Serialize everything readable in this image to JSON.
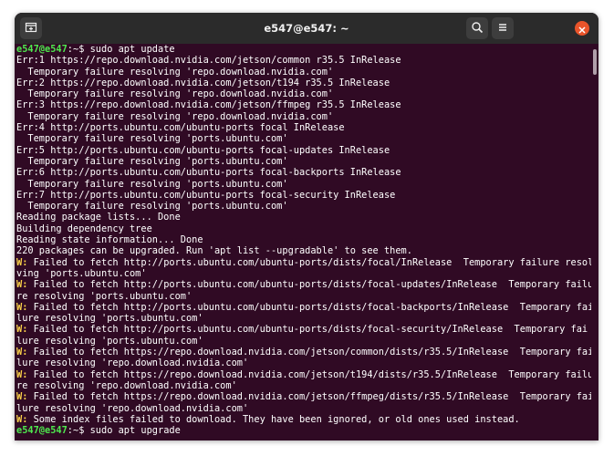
{
  "window": {
    "title": "e547@e547: ~"
  },
  "icons": {
    "new_tab": "new-tab-icon",
    "search": "search-icon",
    "menu": "hamburger-menu-icon",
    "close": "close-icon"
  },
  "colors": {
    "terminal_bg": "#300a24",
    "titlebar_bg": "#2b2b2b",
    "prompt_green": "#4ee94e",
    "warning_yellow": "#ffd54a",
    "close_orange": "#e9542a"
  },
  "terminal": {
    "prompt_user": "e547@e547",
    "prompt_sep": ":~$ ",
    "lines": [
      {
        "type": "prompt",
        "user": "e547@e547",
        "sep": ":~$ ",
        "cmd": "sudo apt update"
      },
      {
        "type": "text",
        "text": "Err:1 https://repo.download.nvidia.com/jetson/common r35.5 InRelease"
      },
      {
        "type": "text",
        "text": "  Temporary failure resolving 'repo.download.nvidia.com'"
      },
      {
        "type": "text",
        "text": "Err:2 https://repo.download.nvidia.com/jetson/t194 r35.5 InRelease"
      },
      {
        "type": "text",
        "text": "  Temporary failure resolving 'repo.download.nvidia.com'"
      },
      {
        "type": "text",
        "text": "Err:3 https://repo.download.nvidia.com/jetson/ffmpeg r35.5 InRelease"
      },
      {
        "type": "text",
        "text": "  Temporary failure resolving 'repo.download.nvidia.com'"
      },
      {
        "type": "text",
        "text": "Err:4 http://ports.ubuntu.com/ubuntu-ports focal InRelease"
      },
      {
        "type": "text",
        "text": "  Temporary failure resolving 'ports.ubuntu.com'"
      },
      {
        "type": "text",
        "text": "Err:5 http://ports.ubuntu.com/ubuntu-ports focal-updates InRelease"
      },
      {
        "type": "text",
        "text": "  Temporary failure resolving 'ports.ubuntu.com'"
      },
      {
        "type": "text",
        "text": "Err:6 http://ports.ubuntu.com/ubuntu-ports focal-backports InRelease"
      },
      {
        "type": "text",
        "text": "  Temporary failure resolving 'ports.ubuntu.com'"
      },
      {
        "type": "text",
        "text": "Err:7 http://ports.ubuntu.com/ubuntu-ports focal-security InRelease"
      },
      {
        "type": "text",
        "text": "  Temporary failure resolving 'ports.ubuntu.com'"
      },
      {
        "type": "text",
        "text": "Reading package lists... Done"
      },
      {
        "type": "text",
        "text": "Building dependency tree"
      },
      {
        "type": "text",
        "text": "Reading state information... Done"
      },
      {
        "type": "text",
        "text": "220 packages can be upgraded. Run 'apt list --upgradable' to see them."
      },
      {
        "type": "warn",
        "tag": "W:",
        "text": " Failed to fetch http://ports.ubuntu.com/ubuntu-ports/dists/focal/InRelease  Temporary failure resol"
      },
      {
        "type": "text",
        "text": "ving 'ports.ubuntu.com'"
      },
      {
        "type": "warn",
        "tag": "W:",
        "text": " Failed to fetch http://ports.ubuntu.com/ubuntu-ports/dists/focal-updates/InRelease  Temporary failu"
      },
      {
        "type": "text",
        "text": "re resolving 'ports.ubuntu.com'"
      },
      {
        "type": "warn",
        "tag": "W:",
        "text": " Failed to fetch http://ports.ubuntu.com/ubuntu-ports/dists/focal-backports/InRelease  Temporary fai"
      },
      {
        "type": "text",
        "text": "lure resolving 'ports.ubuntu.com'"
      },
      {
        "type": "warn",
        "tag": "W:",
        "text": " Failed to fetch http://ports.ubuntu.com/ubuntu-ports/dists/focal-security/InRelease  Temporary fai"
      },
      {
        "type": "text",
        "text": "lure resolving 'ports.ubuntu.com'"
      },
      {
        "type": "warn",
        "tag": "W:",
        "text": " Failed to fetch https://repo.download.nvidia.com/jetson/common/dists/r35.5/InRelease  Temporary fai"
      },
      {
        "type": "text",
        "text": "lure resolving 'repo.download.nvidia.com'"
      },
      {
        "type": "warn",
        "tag": "W:",
        "text": " Failed to fetch https://repo.download.nvidia.com/jetson/t194/dists/r35.5/InRelease  Temporary failu"
      },
      {
        "type": "text",
        "text": "re resolving 'repo.download.nvidia.com'"
      },
      {
        "type": "warn",
        "tag": "W:",
        "text": " Failed to fetch https://repo.download.nvidia.com/jetson/ffmpeg/dists/r35.5/InRelease  Temporary fai"
      },
      {
        "type": "text",
        "text": "lure resolving 'repo.download.nvidia.com'"
      },
      {
        "type": "warn",
        "tag": "W:",
        "text": " Some index files failed to download. They have been ignored, or old ones used instead."
      },
      {
        "type": "prompt",
        "user": "e547@e547",
        "sep": ":~$ ",
        "cmd": "sudo apt upgrade"
      }
    ]
  }
}
